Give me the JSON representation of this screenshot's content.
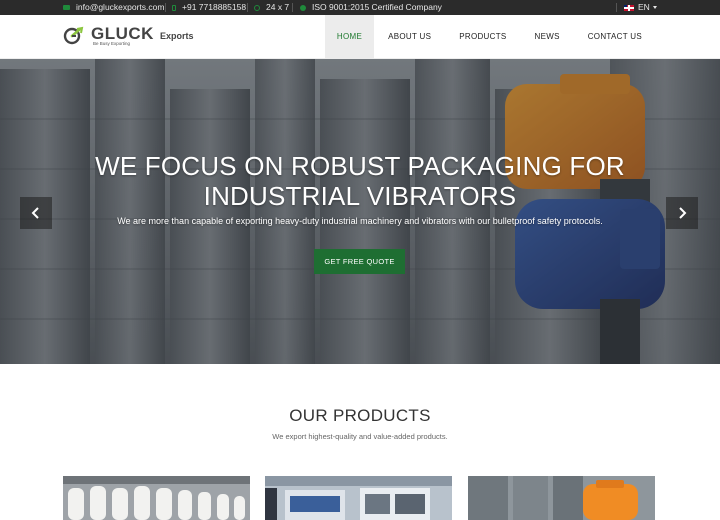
{
  "topbar": {
    "email": "info@gluckexports.com",
    "phone": "+91 7718885158",
    "hours": "24 x 7",
    "certification": "ISO 9001:2015 Certified Company",
    "language": "EN",
    "icons": [
      "mail-icon",
      "phone-icon",
      "clock-icon",
      "certificate-icon",
      "uk-flag-icon"
    ]
  },
  "brand": {
    "name": "GLUCK",
    "suffix": "Exports",
    "tagline": "Be Busy Exporting",
    "accent_color": "#1f7a2f"
  },
  "nav": {
    "items": [
      {
        "label": "HOME",
        "active": true
      },
      {
        "label": "ABOUT US",
        "active": false
      },
      {
        "label": "PRODUCTS",
        "active": false
      },
      {
        "label": "NEWS",
        "active": false
      },
      {
        "label": "CONTACT US",
        "active": false
      }
    ]
  },
  "hero": {
    "title_line1": "WE FOCUS ON ROBUST PACKAGING FOR",
    "title_line2": "INDUSTRIAL VIBRATORS",
    "subtitle": "We are more than capable of exporting heavy-duty industrial machinery and vibrators with our bulletproof safety protocols.",
    "cta_label": "GET FREE QUOTE",
    "cta_color": "#1e6e32",
    "prev_icon": "chevron-left-icon",
    "next_icon": "chevron-right-icon"
  },
  "products": {
    "title": "OUR PRODUCTS",
    "subtitle": "We export highest-quality and value-added products."
  }
}
